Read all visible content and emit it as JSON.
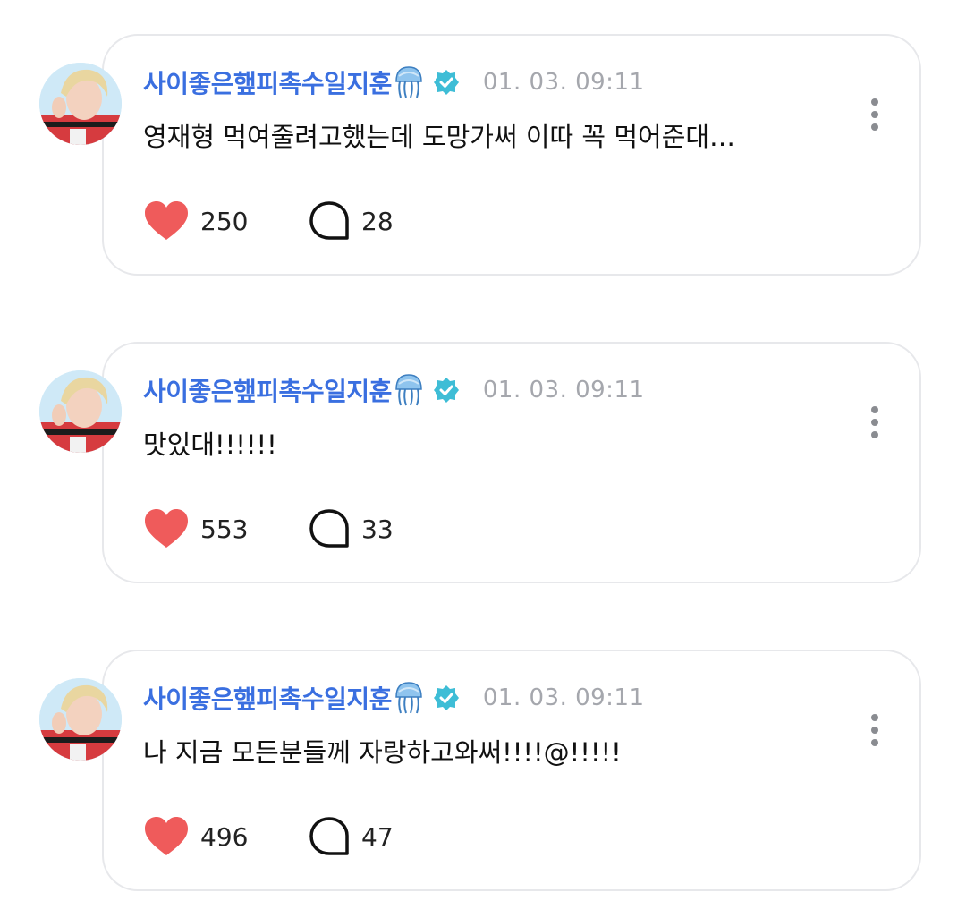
{
  "posts": [
    {
      "username": "사이좋은햎피촉수일지훈",
      "timestamp": "01. 03. 09:11",
      "text": "영재형 먹여줄려고했는데 도망가써 이따 꼭 먹어준대…",
      "likes": "250",
      "comments": "28"
    },
    {
      "username": "사이좋은햎피촉수일지훈",
      "timestamp": "01. 03. 09:11",
      "text": "맛있대!!!!!!",
      "likes": "553",
      "comments": "33"
    },
    {
      "username": "사이좋은햎피촉수일지훈",
      "timestamp": "01. 03. 09:11",
      "text": "나 지금 모든분들께 자랑하고와써!!!!@!!!!!",
      "likes": "496",
      "comments": "47"
    }
  ],
  "icons": {
    "username_emoji": "jellyfish-icon",
    "badge": "verified-badge-icon",
    "menu": "more-vertical-icon",
    "like": "heart-icon",
    "comment": "speech-bubble-icon"
  },
  "colors": {
    "username": "#3a6fe0",
    "verified": "#3ebdd6",
    "heart": "#ef5b5b",
    "timestamp": "#a5a7ad",
    "card_border": "#e7e8eb"
  }
}
